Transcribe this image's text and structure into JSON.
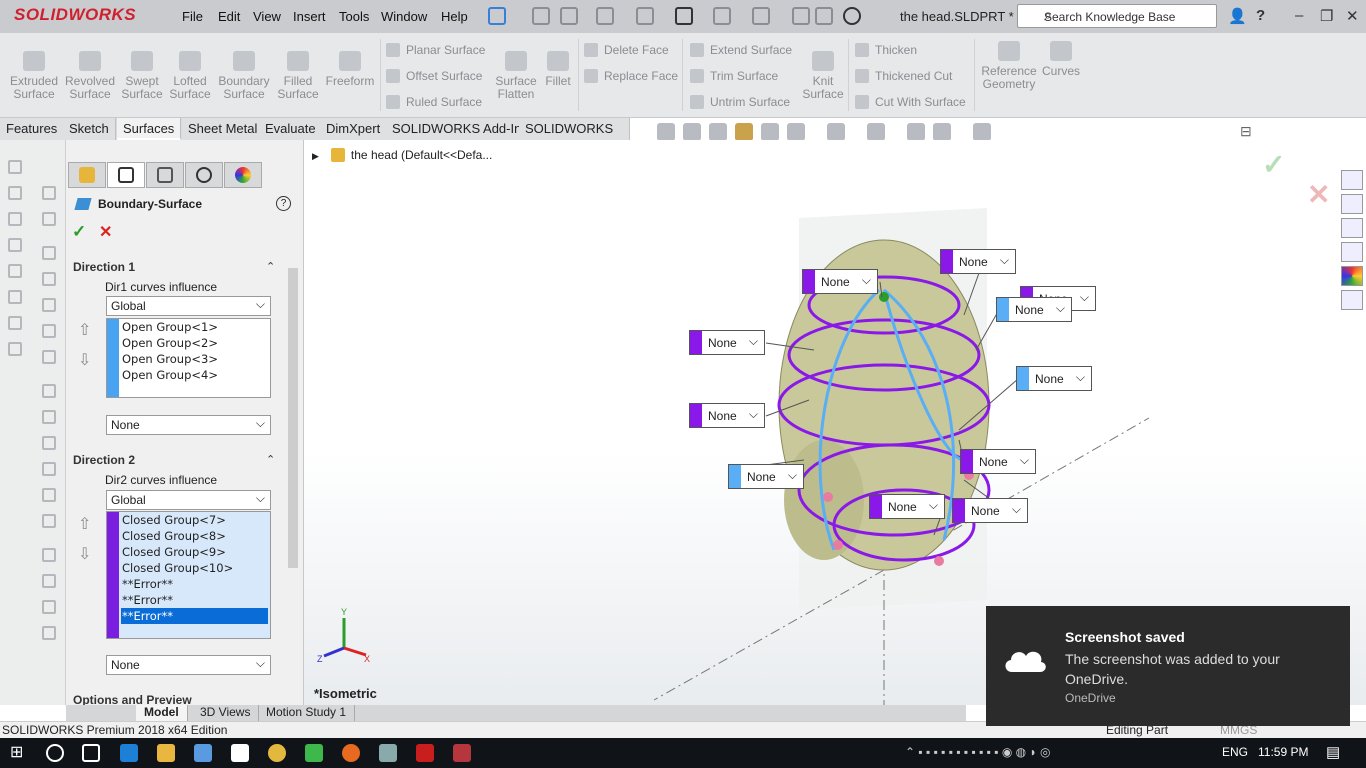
{
  "app": {
    "logo": "SOLIDWORKS",
    "title": "the head.SLDPRT *",
    "search_placeholder": "Search Knowledge Base"
  },
  "menu": [
    "File",
    "Edit",
    "View",
    "Insert",
    "Tools",
    "Window",
    "Help"
  ],
  "ribbon": {
    "big": [
      "Extruded Surface",
      "Revolved Surface",
      "Swept Surface",
      "Lofted Surface",
      "Boundary Surface",
      "Filled Surface",
      "Freeform"
    ],
    "col1": [
      "Planar Surface",
      "Offset Surface",
      "Ruled Surface"
    ],
    "flatten": "Surface Flatten",
    "fillet": "Fillet",
    "col2": [
      "Delete Face",
      "Replace Face"
    ],
    "col3": [
      "Extend Surface",
      "Trim Surface",
      "Untrim Surface"
    ],
    "knit": "Knit Surface",
    "col4": [
      "Thicken",
      "Thickened Cut",
      "Cut With Surface"
    ],
    "refgeom": "Reference Geometry",
    "curves": "Curves"
  },
  "tabs": [
    "Features",
    "Sketch",
    "Surfaces",
    "Sheet Metal",
    "Evaluate",
    "DimXpert",
    "SOLIDWORKS Add-Ins",
    "SOLIDWORKS MBD"
  ],
  "pm": {
    "title": "Boundary-Surface",
    "dir1": {
      "title": "Direction 1",
      "influence_label": "Dir1 curves influence",
      "influence": "Global",
      "items": [
        "Open Group<1>",
        "Open Group<2>",
        "Open Group<3>",
        "Open Group<4>"
      ],
      "tangency": "None",
      "color": "#4aa3f0"
    },
    "dir2": {
      "title": "Direction 2",
      "influence_label": "Dir2 curves influence",
      "influence": "Global",
      "items": [
        "Closed Group<7>",
        "Closed Group<8>",
        "Closed Group<9>",
        "Closed Group<10>",
        "**Error**",
        "**Error**",
        "**Error**"
      ],
      "tangency": "None",
      "color": "#7a1ee0"
    },
    "options": "Options and Preview"
  },
  "tree": {
    "label": "the head  (Default<<Defa..."
  },
  "callouts": [
    {
      "text": "None",
      "color": "#8a18e8"
    },
    {
      "text": "None",
      "color": "#8a18e8"
    },
    {
      "text": "None",
      "color": "#8a18e8"
    },
    {
      "text": "None",
      "color": "#5aaef5"
    },
    {
      "text": "None",
      "color": "#8a18e8"
    },
    {
      "text": "None",
      "color": "#5aaef5"
    },
    {
      "text": "None",
      "color": "#8a18e8"
    },
    {
      "text": "None",
      "color": "#5aaef5"
    },
    {
      "text": "None",
      "color": "#8a18e8"
    },
    {
      "text": "None",
      "color": "#8a18e8"
    },
    {
      "text": "None",
      "color": "#8a18e8"
    }
  ],
  "view": {
    "label": "*Isometric"
  },
  "bottom_tabs": [
    "Model",
    "3D Views",
    "Motion Study 1"
  ],
  "status": {
    "left": "SOLIDWORKS Premium 2018 x64 Edition",
    "mode": "Editing Part",
    "units": "MMGS"
  },
  "toast": {
    "title": "Screenshot saved",
    "message": "The screenshot was added to your OneDrive.",
    "app": "OneDrive"
  },
  "taskbar": {
    "lang": "ENG",
    "time": "11:59 PM"
  }
}
